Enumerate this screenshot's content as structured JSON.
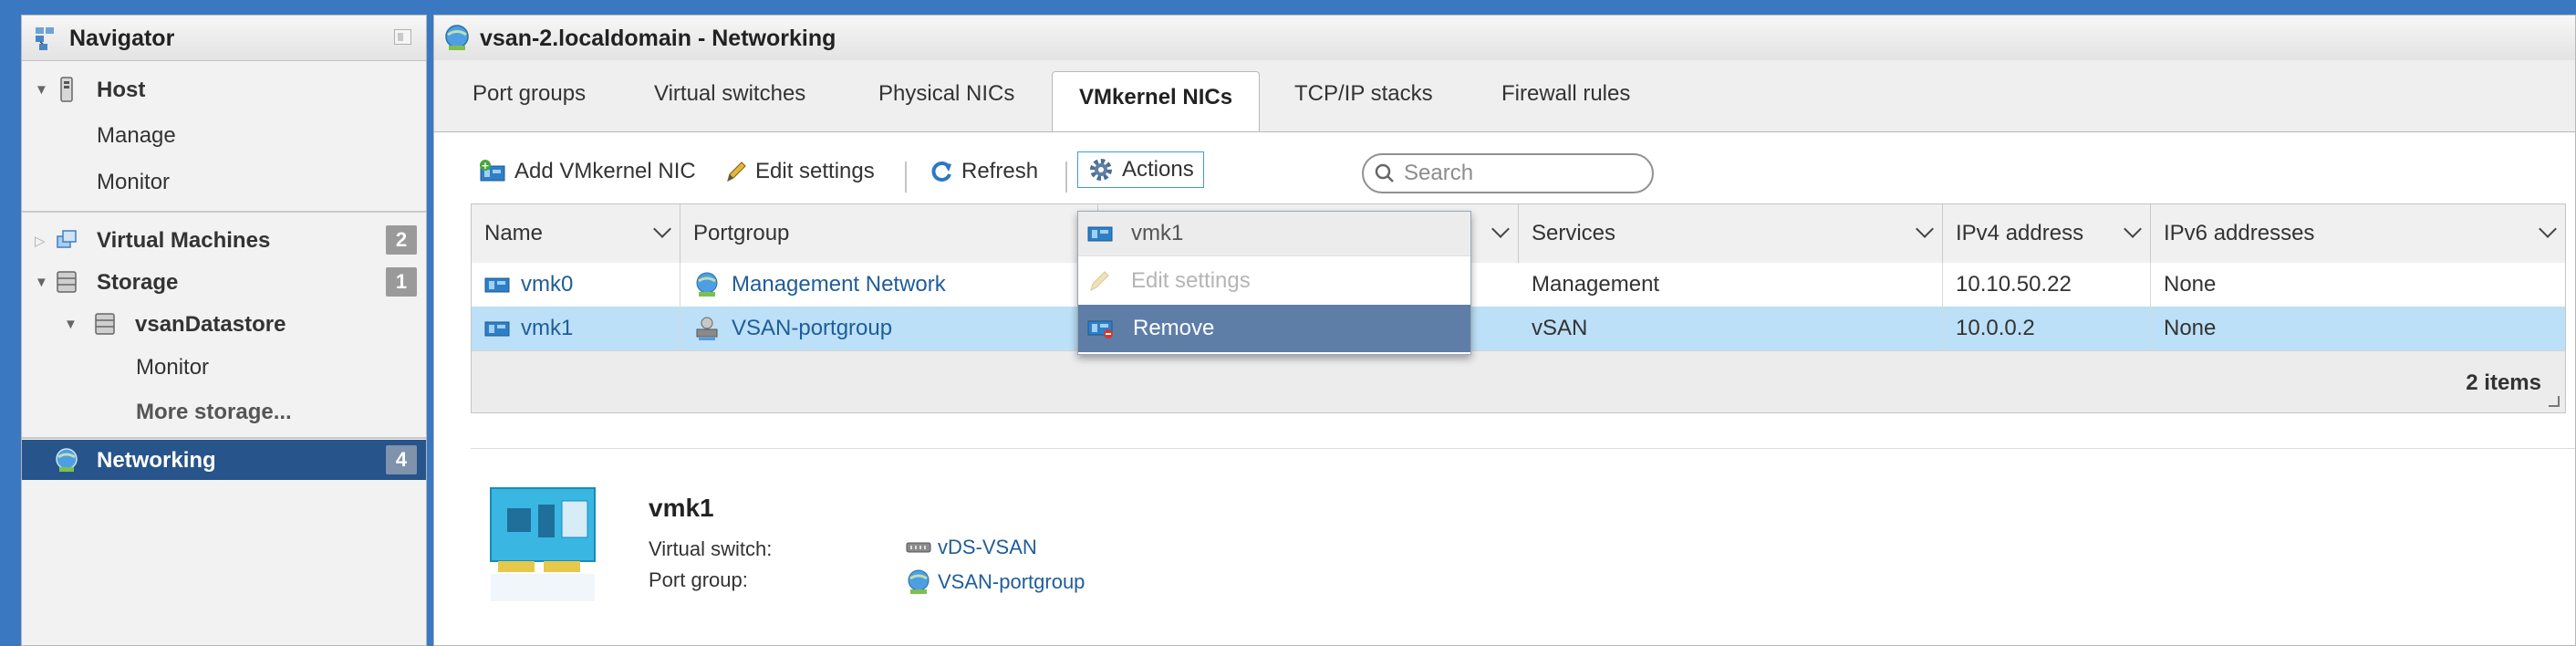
{
  "navigator": {
    "title": "Navigator",
    "items": [
      {
        "label": "Host"
      },
      {
        "label": "Manage"
      },
      {
        "label": "Monitor"
      },
      {
        "label": "Virtual Machines",
        "count": "2"
      },
      {
        "label": "Storage",
        "count": "1"
      },
      {
        "label": "vsanDatastore"
      },
      {
        "label": "Monitor"
      },
      {
        "label": "More storage..."
      },
      {
        "label": "Networking",
        "count": "4"
      }
    ]
  },
  "main": {
    "title": "vsan-2.localdomain - Networking",
    "tabs": [
      {
        "label": "Port groups"
      },
      {
        "label": "Virtual switches"
      },
      {
        "label": "Physical NICs"
      },
      {
        "label": "VMkernel NICs",
        "active": true
      },
      {
        "label": "TCP/IP stacks"
      },
      {
        "label": "Firewall rules"
      }
    ]
  },
  "toolbar": {
    "add_label": "Add VMkernel NIC",
    "edit_label": "Edit settings",
    "refresh_label": "Refresh",
    "actions_label": "Actions",
    "search_placeholder": "Search"
  },
  "grid": {
    "columns": [
      "Name",
      "Portgroup",
      "",
      "Services",
      "IPv4 address",
      "IPv6 addresses"
    ],
    "rows": [
      {
        "name": "vmk0",
        "portgroup": "Management Network",
        "services": "Management",
        "ipv4": "10.10.50.22",
        "ipv6": "None"
      },
      {
        "name": "vmk1",
        "portgroup": "VSAN-portgroup",
        "services": "vSAN",
        "ipv4": "10.0.0.2",
        "ipv6": "None",
        "selected": true
      }
    ],
    "footer": "2 items"
  },
  "dropdown": {
    "header": "vmk1",
    "edit": "Edit settings",
    "remove": "Remove"
  },
  "details": {
    "title": "vmk1",
    "vswitch_label": "Virtual switch:",
    "vswitch_value": "vDS-VSAN",
    "portgroup_label": "Port group:",
    "portgroup_value": "VSAN-portgroup"
  },
  "colors": {
    "background": "#3b78c2",
    "nav_selected": "#27548a",
    "row_selected": "#bce0f7",
    "menu_highlight": "#5e7ea8",
    "link": "#1f5d99"
  }
}
